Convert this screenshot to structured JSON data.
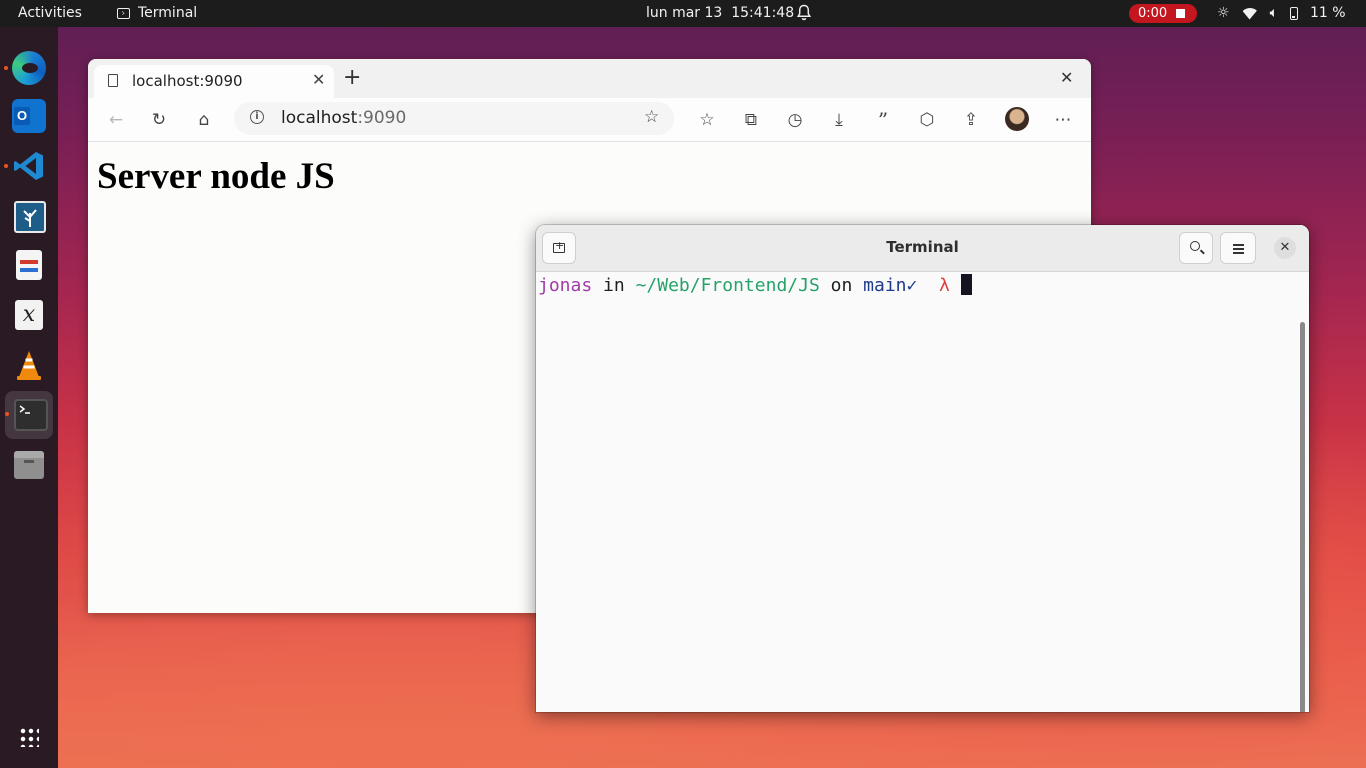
{
  "topbar": {
    "activities": "Activities",
    "app_name": "Terminal",
    "clock": "lun mar 13  15:41:48",
    "recording_time": "0:00",
    "battery": "11 %"
  },
  "dock": {
    "items": [
      "microsoft-edge",
      "outlook",
      "vscode",
      "drawing",
      "document-reader",
      "xournal",
      "vlc",
      "terminal",
      "files"
    ],
    "apps_grid": "show-applications"
  },
  "browser": {
    "tab_title": "localhost:9090",
    "url_host": "localhost",
    "url_port": ":9090",
    "page_heading": "Server node JS"
  },
  "terminal": {
    "title": "Terminal",
    "prompt": {
      "user": "jonas",
      "in": "in",
      "dir": "~/Web/Frontend/JS",
      "on": "on",
      "branch": "main✓",
      "symbol": "λ"
    }
  },
  "colors": {
    "accent": "#e95420",
    "record": "#c4161f",
    "prompt_user": "#a03ba8",
    "prompt_dir": "#26a269",
    "prompt_branch": "#1e3a8a",
    "prompt_symbol": "#e03c3c"
  }
}
